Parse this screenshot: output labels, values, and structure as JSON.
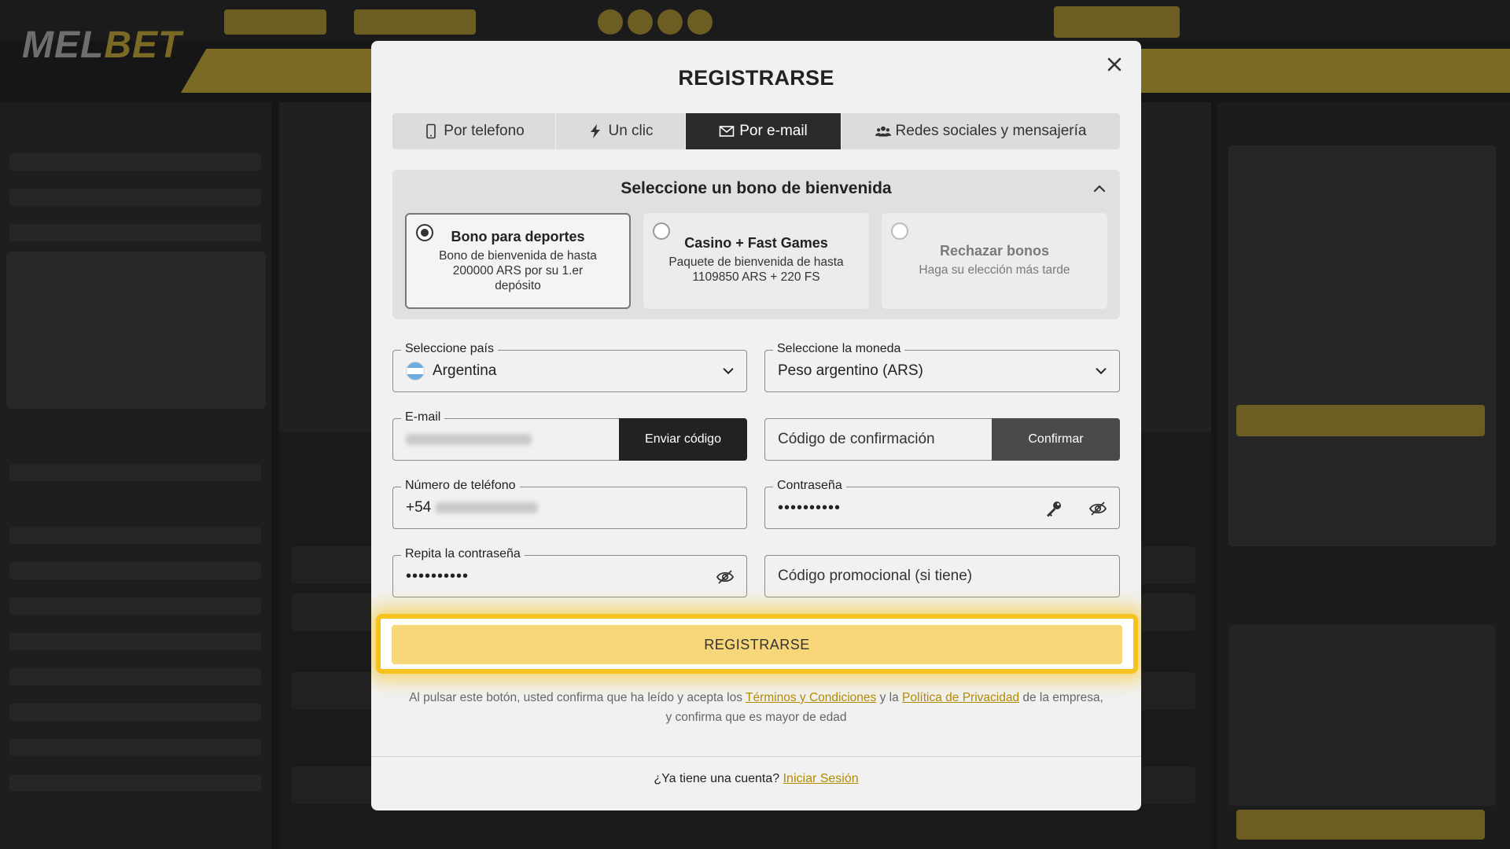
{
  "site": {
    "logo_left": "MEL",
    "logo_right": "BET"
  },
  "modal": {
    "title": "REGISTRARSE",
    "close_icon": "close-icon",
    "tabs": [
      {
        "label": "Por telefono",
        "icon": "phone-icon",
        "active": false
      },
      {
        "label": "Un clic",
        "icon": "lightning-icon",
        "active": false
      },
      {
        "label": "Por e-mail",
        "icon": "envelope-icon",
        "active": true
      },
      {
        "label": "Redes sociales y mensajería",
        "icon": "users-icon",
        "active": false
      }
    ],
    "bonus": {
      "heading": "Seleccione un bono de bienvenida",
      "options": [
        {
          "title": "Bono para deportes",
          "desc": "Bono de bienvenida de hasta 200000 ARS por su 1.er depósito",
          "selected": true
        },
        {
          "title": "Casino + Fast Games",
          "desc": "Paquete de bienvenida de hasta 1109850 ARS + 220 FS",
          "selected": false
        },
        {
          "title": "Rechazar bonos",
          "desc": "Haga su elección más tarde",
          "selected": false
        }
      ]
    },
    "form": {
      "country_label": "Seleccione país",
      "country_value": "Argentina",
      "currency_label": "Seleccione la moneda",
      "currency_value": "Peso argentino (ARS)",
      "email_label": "E-mail",
      "send_code": "Enviar código",
      "confirm_code_placeholder": "Código de confirmación",
      "confirm_button": "Confirmar",
      "phone_label": "Número de teléfono",
      "phone_prefix": "+54",
      "password_label": "Contraseña",
      "password_value": "••••••••••",
      "repeat_password_label": "Repita la contraseña",
      "repeat_password_value": "••••••••••",
      "promo_placeholder": "Código promocional (si tiene)"
    },
    "submit_label": "REGISTRARSE",
    "terms": {
      "part1": "Al pulsar este botón, usted confirma que ha leído y acepta los ",
      "terms_link": "Términos y Condiciones",
      "part2": " y la ",
      "privacy_link": "Política de Privacidad",
      "part3": " de la empresa,",
      "part4": "y confirma que es mayor de edad"
    },
    "login": {
      "question": "¿Ya tiene una cuenta? ",
      "link": "Iniciar Sesión"
    }
  },
  "colors": {
    "highlight": "#f6c31c",
    "submit_bg": "#f8d67a",
    "link": "#b48a00",
    "active_tab": "#2b2b2b"
  }
}
